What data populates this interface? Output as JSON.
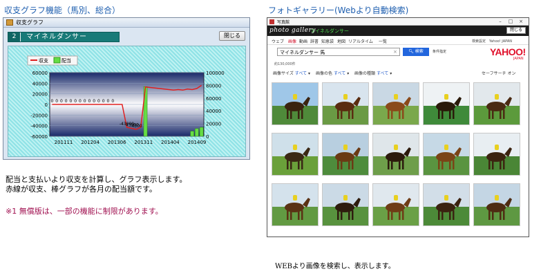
{
  "left_heading": "収支グラフ機能（馬別、総合）",
  "right_heading": "フォトギャラリー(Webより自動検索)",
  "graph_window": {
    "title": "収支グラフ",
    "horse_number": "2",
    "horse_name": "マイネルダンサー",
    "close_label": "閉じる"
  },
  "chart_data": {
    "type": "line",
    "legend": [
      "収支",
      "配当"
    ],
    "legend_placement": "top-left",
    "x_ticks": [
      "201111",
      "201204",
      "201306",
      "201311",
      "201404",
      "201409"
    ],
    "y_left_ticks": [
      "60000",
      "40000",
      "20000",
      "0",
      "-20000",
      "-40000",
      "-60000"
    ],
    "y_left_range": [
      -60000,
      60000
    ],
    "y_right_ticks": [
      "100000",
      "80000",
      "60000",
      "40000",
      "20000",
      "0"
    ],
    "y_right_range": [
      0,
      100000
    ],
    "grid": true,
    "series": [
      {
        "name": "収支",
        "color": "#e02020",
        "values": [
          0,
          0,
          0,
          0,
          0,
          0,
          0,
          0,
          0,
          0,
          0,
          0,
          0,
          0,
          0,
          0,
          -43000,
          -45000,
          -47000,
          -43000,
          33000,
          32000,
          31000,
          30000,
          29000,
          28000,
          27000,
          28000,
          27000,
          29000,
          28000,
          30000,
          36000
        ]
      },
      {
        "name": "配当",
        "color": "#66dd44",
        "values": [
          0,
          0,
          0,
          0,
          0,
          0,
          0,
          0,
          0,
          0,
          0,
          0,
          0,
          0,
          0,
          0,
          0,
          0,
          0,
          0,
          78000,
          0,
          0,
          0,
          0,
          0,
          0,
          0,
          0,
          0,
          8000,
          12000,
          14000
        ]
      }
    ],
    "data_labels": {
      "zero_run": "0",
      "dip": [
        "-43000",
        "-43000",
        "-4500"
      ]
    }
  },
  "descriptions": [
    "配当と支払いより収支を計算し、グラフ表示します。",
    "赤線が収支、棒グラフが各月の配当額です。"
  ],
  "note": "※1 無償版は、一部の機能に制限があります。",
  "gallery_window": {
    "title": "写真館",
    "logo": "photo gallery",
    "query_label": "マイネルダンサー",
    "close_label": "閉じる",
    "nav": [
      "ウェブ",
      "画像",
      "動画",
      "辞書",
      "知恵袋",
      "地図",
      "リアルタイム",
      "一覧"
    ],
    "nav_right": "検索設定　Yahoo! JAPAN",
    "search_value": "マイネルダンサー 馬",
    "search_button": "検索",
    "condition_link": "条件指定",
    "logo_text": "YAHOO!",
    "logo_sub": "JAPAN",
    "result_count": "約130,000件",
    "filters": [
      {
        "label": "画像サイズ",
        "value": "すべて"
      },
      {
        "label": "画像の色",
        "value": "すべて"
      },
      {
        "label": "画像の種類",
        "value": "すべて"
      }
    ],
    "safe_search": "セーフサーチ オン"
  },
  "web_caption": "WEBより画像を検索し、表示します。"
}
